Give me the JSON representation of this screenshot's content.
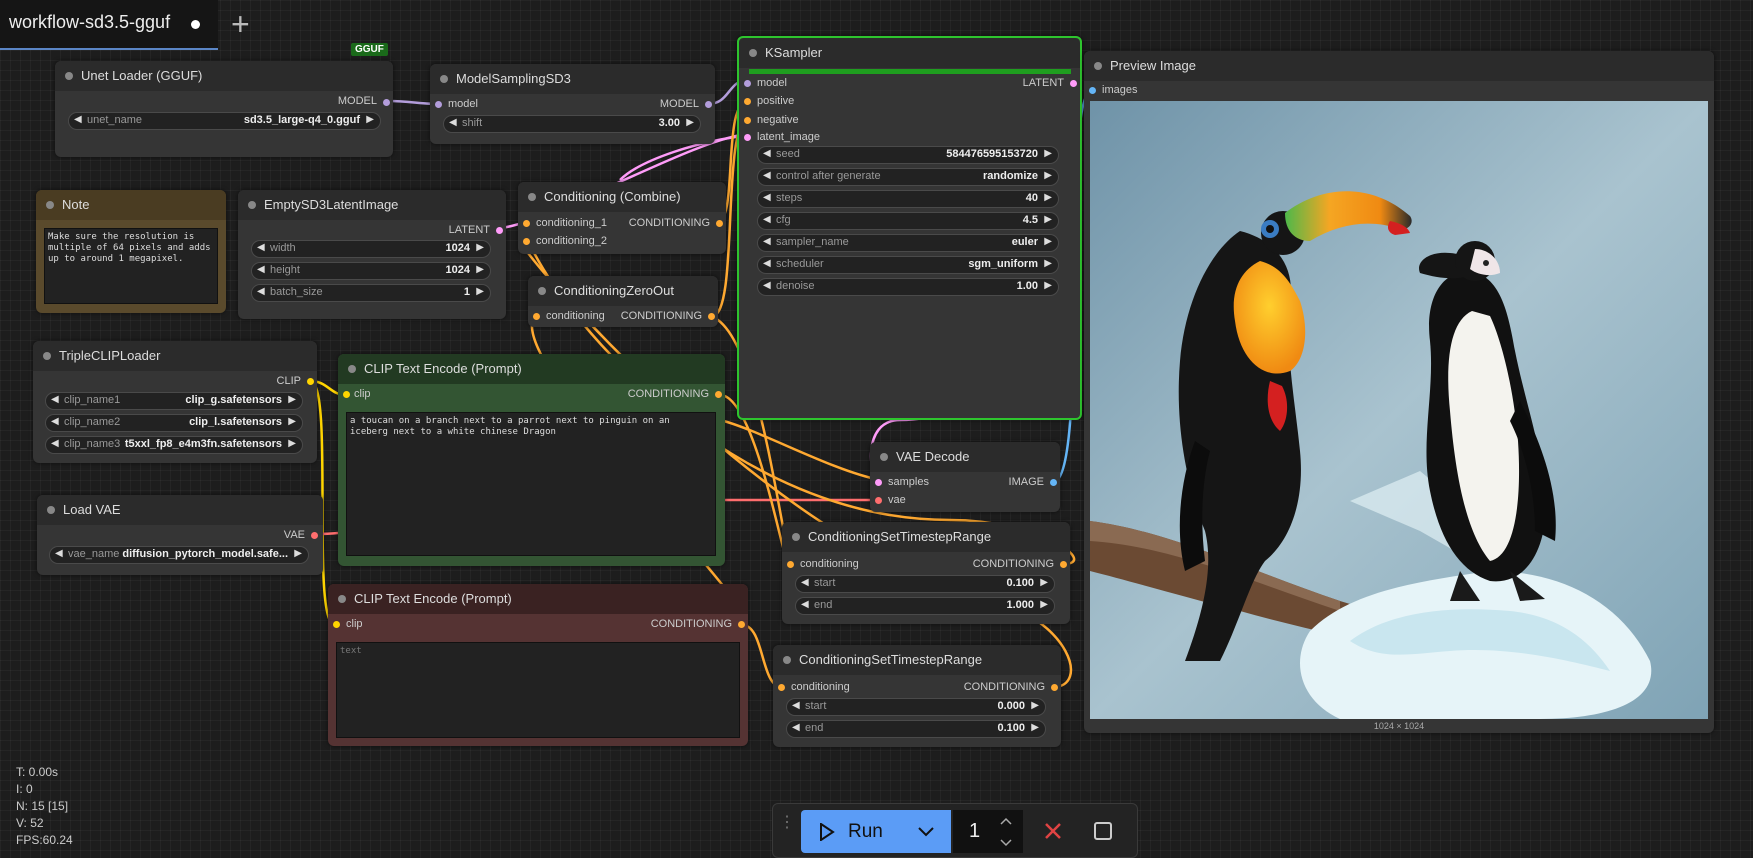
{
  "tab": {
    "title": "workflow-sd3.5-gguf",
    "add_label": "+"
  },
  "badge": "GGUF",
  "nodes": {
    "unet_loader": {
      "title": "Unet Loader (GGUF)",
      "output": "MODEL",
      "widget_label": "unet_name",
      "widget_value": "sd3.5_large-q4_0.gguf"
    },
    "model_sampling": {
      "title": "ModelSamplingSD3",
      "input": "model",
      "output": "MODEL",
      "widget_label": "shift",
      "widget_value": "3.00"
    },
    "note": {
      "title": "Note",
      "text": "Make sure the resolution is multiple of 64 pixels and adds up to around 1 megapixel."
    },
    "empty_latent": {
      "title": "EmptySD3LatentImage",
      "output": "LATENT",
      "width_label": "width",
      "width_value": "1024",
      "height_label": "height",
      "height_value": "1024",
      "batch_label": "batch_size",
      "batch_value": "1"
    },
    "cond_combine": {
      "title": "Conditioning (Combine)",
      "in1": "conditioning_1",
      "in2": "conditioning_2",
      "output": "CONDITIONING"
    },
    "cond_zero": {
      "title": "ConditioningZeroOut",
      "input": "conditioning",
      "output": "CONDITIONING"
    },
    "triple_clip": {
      "title": "TripleCLIPLoader",
      "output": "CLIP",
      "c1_label": "clip_name1",
      "c1_value": "clip_g.safetensors",
      "c2_label": "clip_name2",
      "c2_value": "clip_l.safetensors",
      "c3_label": "clip_name3",
      "c3_value": "t5xxl_fp8_e4m3fn.safetensors"
    },
    "load_vae": {
      "title": "Load VAE",
      "output": "VAE",
      "widget_label": "vae_name",
      "widget_value": "diffusion_pytorch_model.safe..."
    },
    "clip_pos": {
      "title": "CLIP Text Encode (Prompt)",
      "input": "clip",
      "output": "CONDITIONING",
      "text": "a toucan on a branch next to a parrot next to pinguin on an iceberg next to a white chinese Dragon"
    },
    "clip_neg": {
      "title": "CLIP Text Encode (Prompt)",
      "input": "clip",
      "output": "CONDITIONING",
      "placeholder": "text"
    },
    "ksampler": {
      "title": "KSampler",
      "in_model": "model",
      "in_positive": "positive",
      "in_negative": "negative",
      "in_latent": "latent_image",
      "output": "LATENT",
      "seed_label": "seed",
      "seed_value": "584476595153720",
      "control_label": "control after generate",
      "control_value": "randomize",
      "steps_label": "steps",
      "steps_value": "40",
      "cfg_label": "cfg",
      "cfg_value": "4.5",
      "sampler_label": "sampler_name",
      "sampler_value": "euler",
      "scheduler_label": "scheduler",
      "scheduler_value": "sgm_uniform",
      "denoise_label": "denoise",
      "denoise_value": "1.00",
      "progress": 1.0
    },
    "vae_decode": {
      "title": "VAE Decode",
      "in_samples": "samples",
      "in_vae": "vae",
      "output": "IMAGE"
    },
    "ts_range_1": {
      "title": "ConditioningSetTimestepRange",
      "input": "conditioning",
      "output": "CONDITIONING",
      "start_label": "start",
      "start_value": "0.100",
      "end_label": "end",
      "end_value": "1.000"
    },
    "ts_range_2": {
      "title": "ConditioningSetTimestepRange",
      "input": "conditioning",
      "output": "CONDITIONING",
      "start_label": "start",
      "start_value": "0.000",
      "end_label": "end",
      "end_value": "0.100"
    },
    "preview": {
      "title": "Preview Image",
      "input": "images",
      "caption": "1024 × 1024"
    }
  },
  "stats": {
    "t": "T: 0.00s",
    "i": "I: 0",
    "n": "N: 15 [15]",
    "v": "V: 52",
    "fps": "FPS:60.24"
  },
  "runbar": {
    "run_label": "Run",
    "batch_count": "1"
  },
  "colors": {
    "model": "#b39ddb",
    "latent": "#ff9cf9",
    "conditioning": "#ffa931",
    "clip": "#ffd500",
    "vae": "#ff6e6e",
    "image": "#64b5f6",
    "accent": "#5b9cf6",
    "ksampler_border": "#2ec52e",
    "progress": "#1f9e1f",
    "stop": "#e04343"
  }
}
